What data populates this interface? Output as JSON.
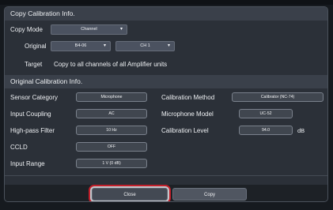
{
  "dialog": {
    "title": "Copy Calibration Info.",
    "copy_mode": {
      "label": "Copy Mode",
      "selected": "Channel"
    },
    "original": {
      "label": "Original",
      "unit_value": "B4-06",
      "channel_value": "CH 1"
    },
    "target": {
      "label": "Target",
      "text": "Copy to all channels of all Amplifier units"
    },
    "original_info": {
      "title": "Original Calibration Info.",
      "left_fields": [
        {
          "label": "Sensor Category",
          "value": "Microphone"
        },
        {
          "label": "Input Coupling",
          "value": "AC"
        },
        {
          "label": "High-pass Filter",
          "value": "10 Hz"
        },
        {
          "label": "CCLD",
          "value": "OFF"
        },
        {
          "label": "Input Range",
          "value": "1 V (0 dB)"
        }
      ],
      "right_fields": [
        {
          "label": "Calibration Method",
          "value": "Calibrator  (NC-74)"
        },
        {
          "label": "Microphone Model",
          "value": "UC-52"
        },
        {
          "label": "Calibration Level",
          "value": "94.0",
          "unit": "dB"
        }
      ]
    },
    "buttons": {
      "close": "Close",
      "copy": "Copy"
    }
  }
}
